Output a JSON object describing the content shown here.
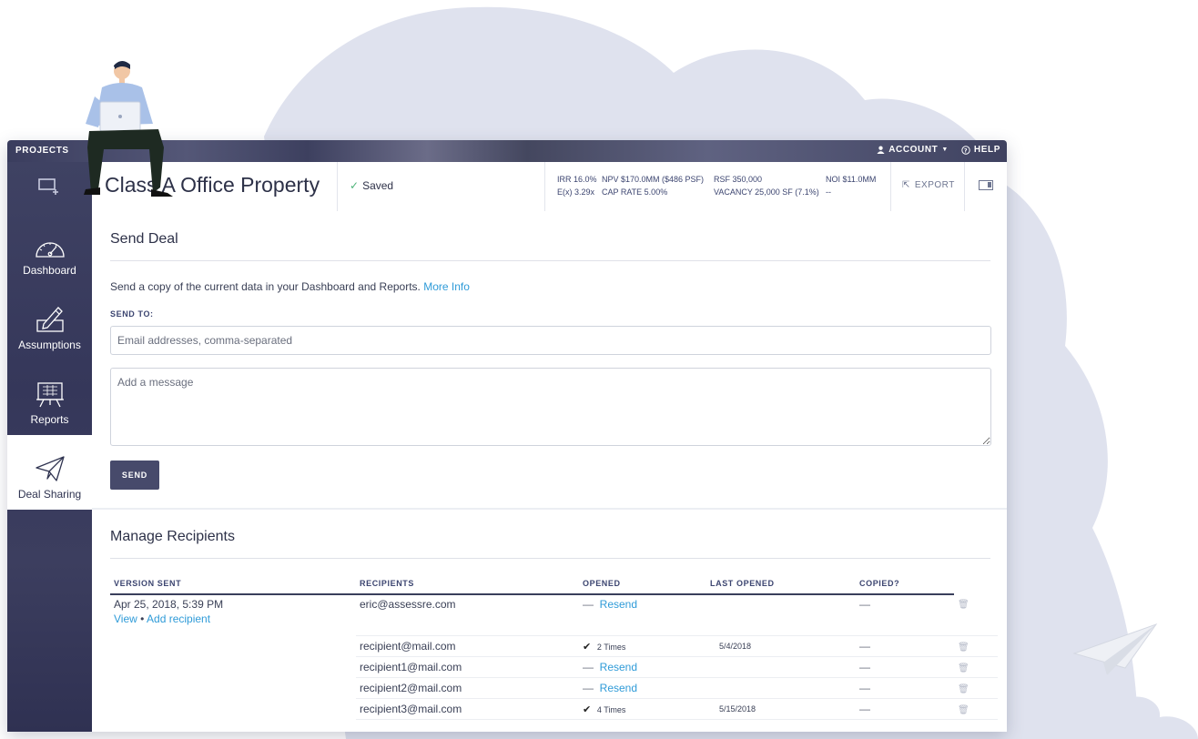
{
  "topbar": {
    "projects_label": "PROJECTS",
    "account_label": "ACCOUNT",
    "help_label": "HELP"
  },
  "sidebar": {
    "items": [
      {
        "label": "Dashboard",
        "icon": "gauge-icon"
      },
      {
        "label": "Assumptions",
        "icon": "pencil-icon"
      },
      {
        "label": "Reports",
        "icon": "easel-icon"
      },
      {
        "label": "Deal Sharing",
        "icon": "paper-plane-icon",
        "active": true
      }
    ]
  },
  "header": {
    "project_title": "Class A Office Property",
    "saved_label": "Saved",
    "metrics": {
      "irr": "IRR 16.0%",
      "npv": "NPV $170.0MM ($486 PSF)",
      "rsf": "RSF 350,000",
      "noi": "NOI $11.0MM",
      "ex": "E(x) 3.29x",
      "cap_rate": "CAP RATE 5.00%",
      "vacancy": "VACANCY 25,000 SF (7.1%)",
      "noi_sub": "--"
    },
    "export_label": "EXPORT"
  },
  "send_deal": {
    "title": "Send Deal",
    "description": "Send a copy of the current data in your Dashboard and Reports.",
    "more_info": "More Info",
    "send_to_label": "SEND TO:",
    "email_placeholder": "Email addresses, comma-separated",
    "message_placeholder": "Add a message",
    "send_button": "SEND"
  },
  "manage": {
    "title": "Manage Recipients",
    "columns": {
      "version": "VERSION SENT",
      "recipients": "RECIPIENTS",
      "opened": "OPENED",
      "last_opened": "LAST OPENED",
      "copied": "COPIED?"
    },
    "version_date": "Apr 25, 2018, 5:39 PM",
    "view_link": "View",
    "bullet": "•",
    "add_recipient_link": "Add recipient",
    "rows": [
      {
        "email": "eric@assessre.com",
        "opened_dash": "—",
        "opened_action": "Resend",
        "last_opened": "",
        "copied": "—"
      },
      {
        "email": "recipient@mail.com",
        "opened_check": "✔",
        "opened_times": "2 Times",
        "last_opened": "5/4/2018",
        "copied": "—"
      },
      {
        "email": "recipient1@mail.com",
        "opened_dash": "—",
        "opened_action": "Resend",
        "last_opened": "",
        "copied": "—"
      },
      {
        "email": "recipient2@mail.com",
        "opened_dash": "—",
        "opened_action": "Resend",
        "last_opened": "",
        "copied": "—"
      },
      {
        "email": "recipient3@mail.com",
        "opened_check": "✔",
        "opened_times": "4 Times",
        "last_opened": "5/15/2018",
        "copied": "—"
      }
    ]
  },
  "colors": {
    "brand_dark": "#474a6b",
    "link": "#2f9bd8",
    "saved_check": "#4fb37a",
    "cloud": "#dfe2ee"
  }
}
